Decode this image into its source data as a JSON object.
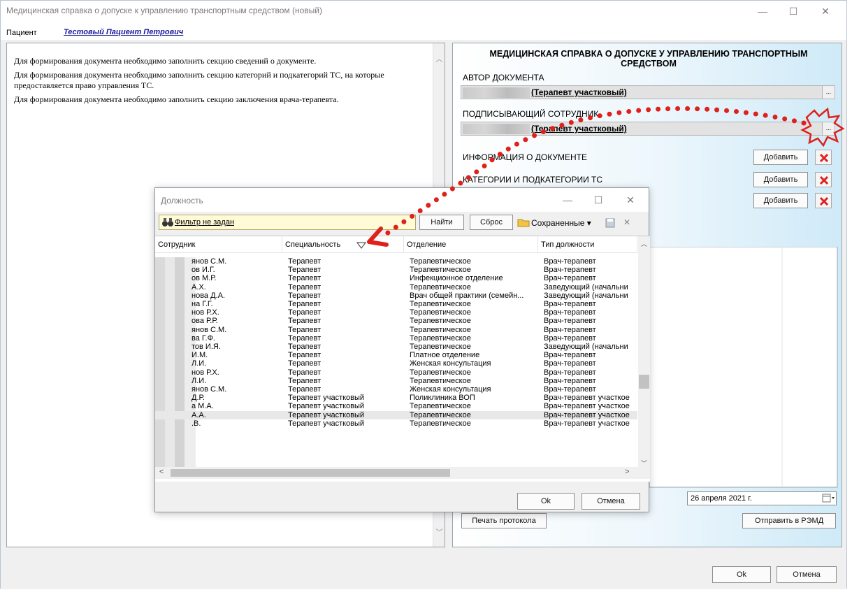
{
  "window": {
    "title": "Медицинская справка о допуске к управлению транспортным средством (новый)",
    "minimize": "—",
    "maximize": "☐",
    "close": "✕"
  },
  "patient": {
    "label": "Пациент",
    "name": "Тестовый Пациент Петрович"
  },
  "messages": [
    "Для формирования документа необходимо заполнить секцию сведений о документе.",
    "Для формирования документа необходимо заполнить секцию категорий и подкатегорий ТС, на которые предоставляется право управления ТС.",
    "Для формирования документа необходимо заполнить секцию заключения врача-терапевта."
  ],
  "right": {
    "title": "МЕДИЦИНСКАЯ СПРАВКА О ДОПУСКЕ У УПРАВЛЕНИЮ ТРАНСПОРТНЫМ СРЕДСТВОМ",
    "author_label": "АВТОР ДОКУМЕНТА",
    "author_value": "(Терапевт участковый)",
    "signer_label": "ПОДПИСЫВАЮЩИЙ СОТРУДНИК",
    "signer_value": "(Терапевт участковый)",
    "ellipsis": "...",
    "doc_info_label": "ИНФОРМАЦИЯ О ДОКУМЕНТЕ",
    "categories_label": "КАТЕГОРИИ И ПОДКАТЕГОРИИ ТС",
    "add_label": "Добавить",
    "date": "26  апреля  2021 г.",
    "print_label": "Печать протокола",
    "send_label": "Отправить в РЭМД"
  },
  "footer": {
    "ok": "Ok",
    "cancel": "Отмена"
  },
  "dialog": {
    "title": "Должность",
    "filter": "Фильтр не задан",
    "find": "Найти",
    "reset": "Сброс",
    "saved": "Сохраненные ▾",
    "ok": "Ok",
    "cancel": "Отмена",
    "columns": [
      "Сотрудник",
      "Специальность",
      "Отделение",
      "Тип должности"
    ],
    "rows": [
      [
        "янов С.М.",
        "Терапевт",
        "Терапевтическое",
        "Врач-терапевт"
      ],
      [
        "ов И.Г.",
        "Терапевт",
        "Терапевтическое",
        "Врач-терапевт"
      ],
      [
        "ов М.Р.",
        "Терапевт",
        "Инфекционное отделение",
        "Врач-терапевт"
      ],
      [
        "А.Х.",
        "Терапевт",
        "Терапевтическое",
        "Заведующий (начальни"
      ],
      [
        "нова Д.А.",
        "Терапевт",
        "Врач общей практики (семейн...",
        "Заведующий (начальни"
      ],
      [
        "на Г.Г.",
        "Терапевт",
        "Терапевтическое",
        "Врач-терапевт"
      ],
      [
        "нов Р.Х.",
        "Терапевт",
        "Терапевтическое",
        "Врач-терапевт"
      ],
      [
        "ова Р.Р.",
        "Терапевт",
        "Терапевтическое",
        "Врач-терапевт"
      ],
      [
        "янов С.М.",
        "Терапевт",
        "Терапевтическое",
        "Врач-терапевт"
      ],
      [
        "ва Г.Ф.",
        "Терапевт",
        "Терапевтическое",
        "Врач-терапевт"
      ],
      [
        "тов И.Я.",
        "Терапевт",
        "Терапевтическое",
        "Заведующий (начальни"
      ],
      [
        "И.М.",
        "Терапевт",
        "Платное отделение",
        "Врач-терапевт"
      ],
      [
        "Л.И.",
        "Терапевт",
        "Женская консультация",
        "Врач-терапевт"
      ],
      [
        "нов Р.Х.",
        "Терапевт",
        "Терапевтическое",
        "Врач-терапевт"
      ],
      [
        "Л.И.",
        "Терапевт",
        "Терапевтическое",
        "Врач-терапевт"
      ],
      [
        "янов С.М.",
        "Терапевт",
        "Женская консультация",
        "Врач-терапевт"
      ],
      [
        "Д.Р.",
        "Терапевт участковый",
        "Поликлиника ВОП",
        "Врач-терапевт участкое"
      ],
      [
        "а М.А.",
        "Терапевт участковый",
        "Терапевтическое",
        "Врач-терапевт участкое"
      ],
      [
        "А.А.",
        "Терапевт участковый",
        "Терапевтическое",
        "Врач-терапевт участкое"
      ],
      [
        ".В.",
        "Терапевт участковый",
        "Терапевтическое",
        "Врач-терапевт участкое"
      ]
    ]
  },
  "colors": {
    "annotation": "#e0201a",
    "link": "#1a1a9a",
    "filter_bg": "#fffbd6"
  }
}
